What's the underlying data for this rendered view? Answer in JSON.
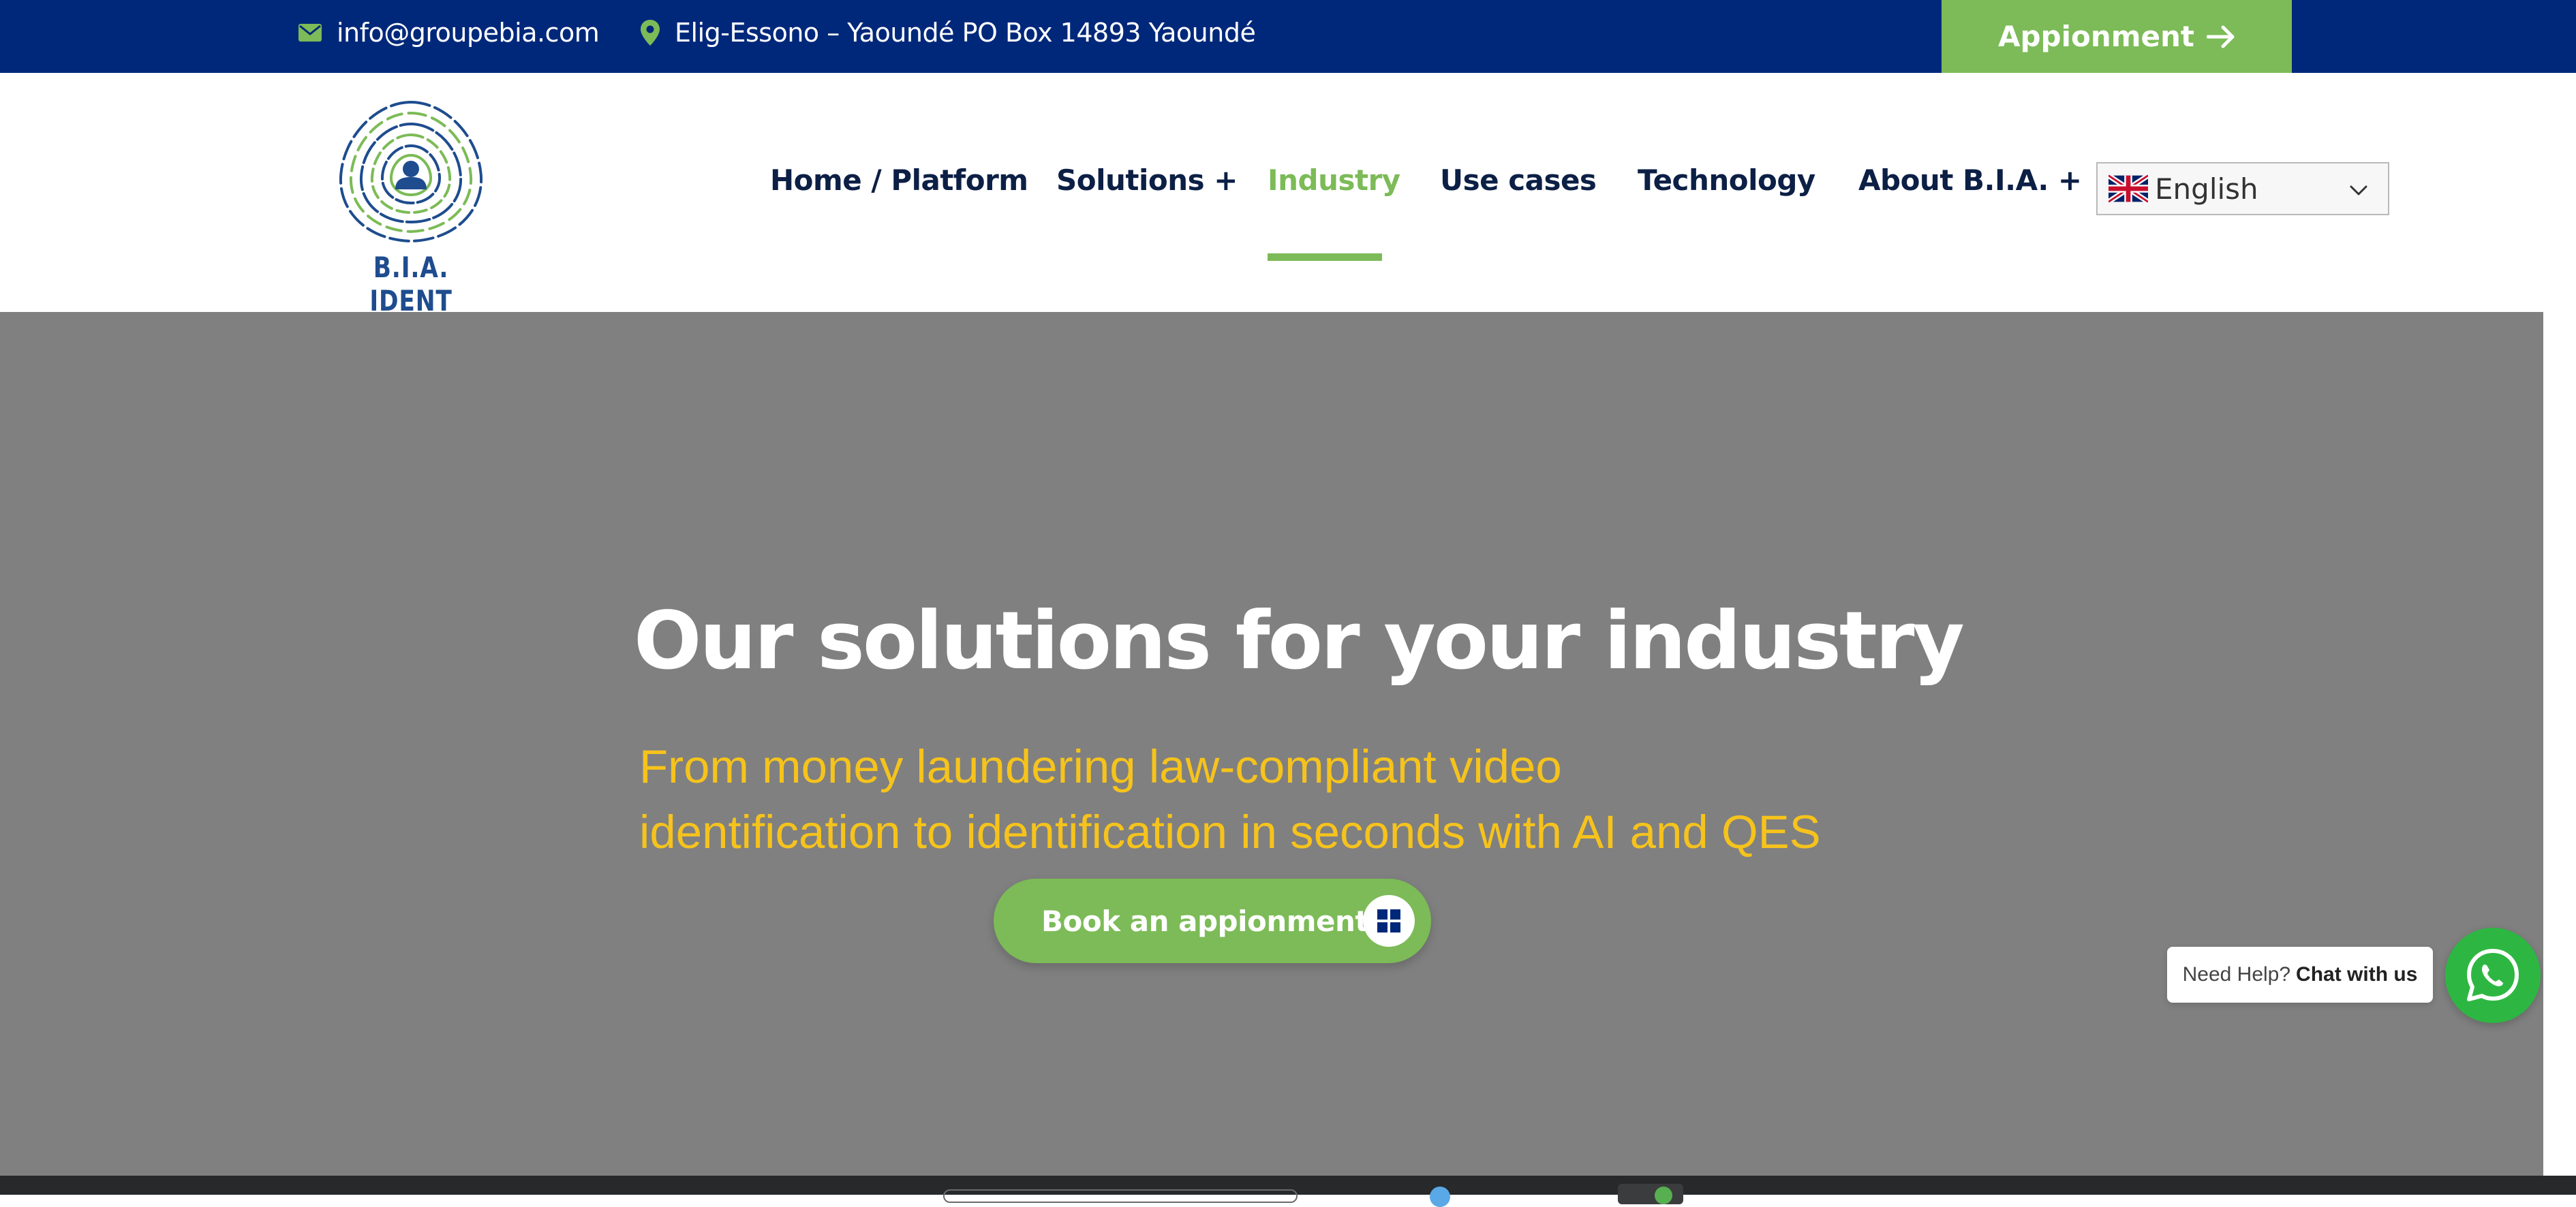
{
  "topbar": {
    "email": "info@groupebia.com",
    "address": "Elig-Essono – Yaoundé PO Box 14893 Yaoundé",
    "appointment_button": "Appionment"
  },
  "logo": {
    "text": "B.I.A. IDENT"
  },
  "nav": {
    "items": [
      {
        "label": "Home / Platform"
      },
      {
        "label": "Solutions +"
      },
      {
        "label": "Industry"
      },
      {
        "label": "Use cases"
      },
      {
        "label": "Technology"
      },
      {
        "label": "About B.I.A. +"
      }
    ],
    "active": "Industry"
  },
  "language": {
    "selected": "English"
  },
  "hero": {
    "title": "Our solutions for your industry",
    "subtitle_line1": "From money laundering law-compliant video",
    "subtitle_line2": "identification to identification in seconds with AI and QES",
    "button_label": "Book an appionment"
  },
  "chat": {
    "prompt": "Need Help?",
    "action": "Chat with us"
  },
  "colors": {
    "topbar": "#00287a",
    "accent_green": "#7cbb57",
    "hero_bg": "#808080",
    "subtitle_yellow": "#f6c31c",
    "nav_text": "#0c1f45",
    "whatsapp": "#2db742"
  },
  "icons": {
    "email": "envelope-icon",
    "address": "map-pin-icon",
    "appointment": "arrow-right-icon",
    "language": "uk-flag-icon",
    "dropdown": "chevron-down-icon",
    "hero_button": "grid-icon",
    "chat": "whatsapp-icon"
  }
}
